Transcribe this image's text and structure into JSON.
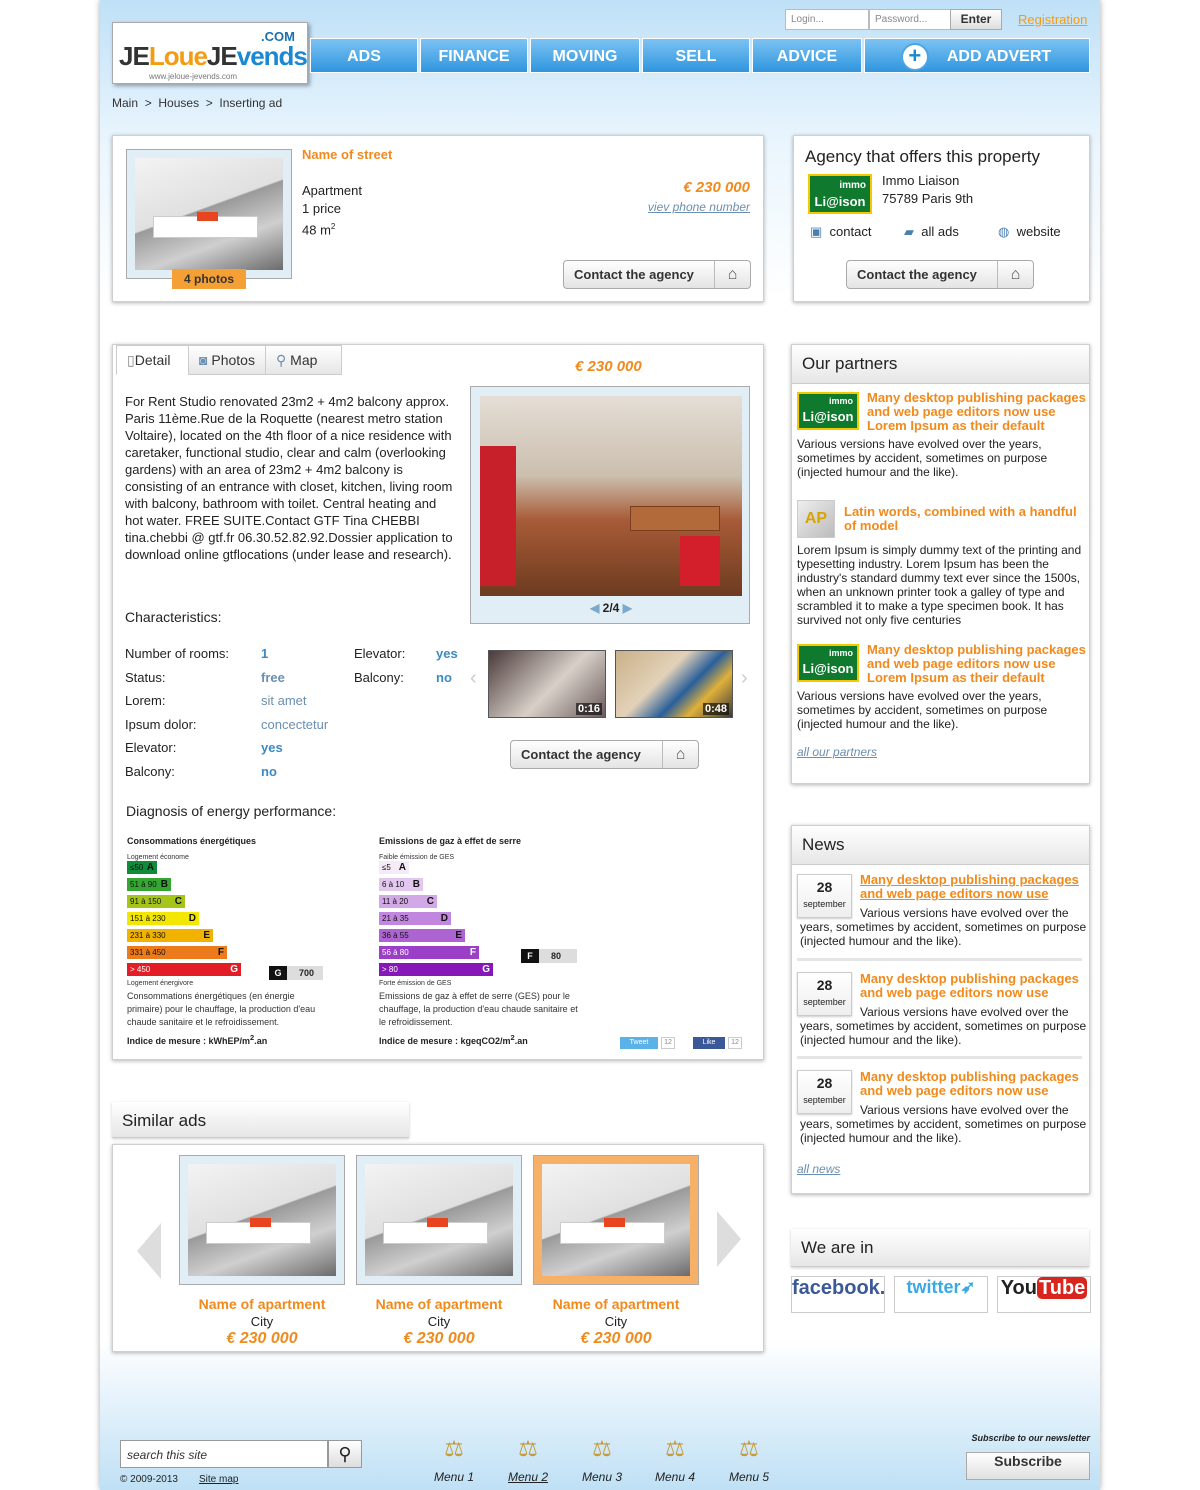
{
  "header": {
    "logo_je1": "JE",
    "logo_loue": "Loue",
    "logo_je2": "JE",
    "logo_vends": "vends",
    "logo_com": ".COM",
    "logo_url": "www.jeloue-jevends.com",
    "login_placeholder": "Login...",
    "password_placeholder": "Password...",
    "enter": "Enter",
    "registration": "Registration"
  },
  "nav": [
    "ADS",
    "FINANCE",
    "MOVING",
    "SELL",
    "ADVICE"
  ],
  "add_advert": "ADD ADVERT",
  "breadcrumb": [
    "Main",
    ">",
    "Houses",
    ">",
    "Inserting ad"
  ],
  "listing": {
    "street": "Name of street",
    "type": "Apartment",
    "price_count": "1 price",
    "area": "48 m",
    "area_sup": "2",
    "price": "€ 230 000",
    "phone_link": "viev phone number",
    "photos_badge": "4 photos",
    "contact": "Contact the agency"
  },
  "agency": {
    "title": "Agency that offers this property",
    "logo_top": "immo",
    "logo_bottom": "Li@ison",
    "name": "Immo Liaison",
    "address": "75789 Paris 9th",
    "contact": "contact",
    "all_ads": "all ads",
    "website": "website",
    "contact_btn": "Contact the agency"
  },
  "detail": {
    "tabs": [
      "Detail",
      "Photos",
      "Map"
    ],
    "price": "€ 230 000",
    "description": "For Rent Studio renovated 23m2 + 4m2 balcony approx. Paris 11ème.Rue de la Roquette (nearest metro station Voltaire), located on the 4th floor of a nice residence with caretaker, functional studio, clear and calm (overlooking gardens) with an area of 23m2 + 4m2 balcony is consisting of an entrance with closet, kitchen, living room with balcony, bathroom with toilet. Central heating and hot water. FREE SUITE.Contact GTF Tina CHEBBI tina.chebbi @ gtf.fr 06.30.52.82.92.Dossier application to download online gtflocations (under lease and research).",
    "characteristics": "Characteristics:",
    "pager": "2/4",
    "video1": "0:16",
    "video2": "0:48",
    "contact_btn": "Contact the agency",
    "chars_left": [
      {
        "k": "Number of rooms:",
        "v": "1"
      },
      {
        "k": "Status:",
        "v": "free"
      },
      {
        "k": "Lorem:",
        "v": "sit amet"
      },
      {
        "k": "Ipsum dolor:",
        "v": "concectetur"
      },
      {
        "k": "Elevator:",
        "v": "yes"
      },
      {
        "k": "Balcony:",
        "v": "no"
      }
    ],
    "chars_right": [
      {
        "k": "Elevator:",
        "v": "yes"
      },
      {
        "k": "Balcony:",
        "v": "no"
      }
    ],
    "energy_title": "Diagnosis of energy performance:"
  },
  "energy": {
    "title": "Consommations énergétiques",
    "top": "Logement économe",
    "bottom": "Logement énergivore",
    "classes": [
      {
        "r": "≤50",
        "l": "A",
        "c": "#0e8c3a"
      },
      {
        "r": "51 à 90",
        "l": "B",
        "c": "#36a632"
      },
      {
        "r": "91 à 150",
        "l": "C",
        "c": "#a6c51a"
      },
      {
        "r": "151 à 230",
        "l": "D",
        "c": "#f3e600"
      },
      {
        "r": "231 à 330",
        "l": "E",
        "c": "#f2b300"
      },
      {
        "r": "331 à 450",
        "l": "F",
        "c": "#ec7b1b"
      },
      {
        "r": "> 450",
        "l": "G",
        "c": "#e31d25"
      }
    ],
    "marker_letter": "G",
    "marker_value": "700",
    "note": "Consommations énergétiques (en énergie primaire) pour le chauffage, la production d'eau chaude sanitaire et le refroidissement.",
    "unit_pre": "Indice de mesure : kWhEP/m",
    "unit_sup": "2",
    "unit_post": ".an"
  },
  "ges": {
    "title": "Emissions de gaz à effet de serre",
    "top": "Faible émission de GES",
    "bottom": "Forte émission de GES",
    "classes": [
      {
        "r": "≤5",
        "l": "A",
        "c": "#f4eaf8"
      },
      {
        "r": "6 à 10",
        "l": "B",
        "c": "#e2c8ef"
      },
      {
        "r": "11 à 20",
        "l": "C",
        "c": "#d2a9e6"
      },
      {
        "r": "21 à 35",
        "l": "D",
        "c": "#c186dd"
      },
      {
        "r": "36 à 55",
        "l": "E",
        "c": "#ad63d2"
      },
      {
        "r": "56 à 80",
        "l": "F",
        "c": "#9a3fc6"
      },
      {
        "r": "> 80",
        "l": "G",
        "c": "#8618b8"
      }
    ],
    "marker_letter": "F",
    "marker_value": "80",
    "note": "Emissions de gaz à effet de serre (GES) pour le chauffage, la production d'eau chaude sanitaire et le refroidissement.",
    "unit_pre": "Indice de mesure : kgeqCO2/m",
    "unit_sup": "2",
    "unit_post": ".an"
  },
  "share": {
    "tweet": "Tweet",
    "tweet_count": "12",
    "like": "Like",
    "like_count": "12"
  },
  "partners": {
    "title": "Our partners",
    "items": [
      {
        "title": "Many desktop publishing packages and web page editors now use Lorem Ipsum as their default",
        "text": "Various versions have evolved over the years, sometimes by accident, sometimes on purpose (injected humour and the like)."
      },
      {
        "title": "Latin words, combined with a handful of model",
        "text": "Lorem Ipsum is simply dummy text of the printing and typesetting industry. Lorem Ipsum has been the industry's standard dummy text ever since the 1500s, when an unknown printer took a galley of type and scrambled it to make a type specimen book. It has survived not only five centuries"
      },
      {
        "title": "Many desktop publishing packages and web page editors now use Lorem Ipsum as their default",
        "text": "Various versions have evolved over the years, sometimes by accident, sometimes on purpose (injected humour and the like)."
      }
    ],
    "all": "all our partners"
  },
  "news": {
    "title": "News",
    "items": [
      {
        "day": "28",
        "month": "september",
        "title": "Many desktop publishing packages and web page editors now use",
        "text": "Various versions have evolved over the years, sometimes by accident, sometimes on purpose (injected humour and the like)."
      },
      {
        "day": "28",
        "month": "september",
        "title": "Many desktop publishing packages and web page editors now use",
        "text": "Various versions have evolved over the years, sometimes by accident, sometimes on purpose (injected humour and the like)."
      },
      {
        "day": "28",
        "month": "september",
        "title": "Many desktop publishing packages and web page editors now use",
        "text": "Various versions have evolved over the years, sometimes by accident, sometimes on purpose (injected humour and the like)."
      }
    ],
    "all": "all news"
  },
  "social": {
    "title": "We are in",
    "facebook": "facebook.",
    "twitter": "twitter",
    "you": "You",
    "tube": "Tube"
  },
  "similar": {
    "title": "Similar ads",
    "items": [
      {
        "name": "Name of apartment",
        "city": "City",
        "price": "€ 230 000"
      },
      {
        "name": "Name of apartment",
        "city": "City",
        "price": "€ 230 000"
      },
      {
        "name": "Name of apartment",
        "city": "City",
        "price": "€ 230 000"
      }
    ]
  },
  "footer": {
    "search_placeholder": "search this site",
    "copyright": "© 2009-2013",
    "sitemap": "Site map",
    "menus": [
      "Menu 1",
      "Menu 2",
      "Menu 3",
      "Menu 4",
      "Menu 5"
    ],
    "newsletter": "Subscribe to our newsletter",
    "subscribe": "Subscribe"
  }
}
